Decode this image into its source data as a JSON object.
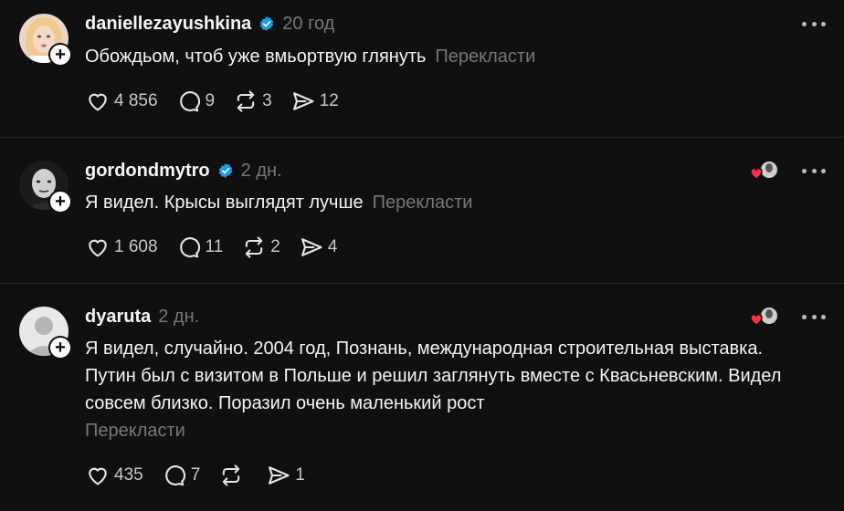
{
  "posts": [
    {
      "username": "daniellezayushkina",
      "verified": true,
      "time": "20 год",
      "text": "Обождьом, чтоб уже вмьортвую глянуть",
      "translate_label": "Перекласти",
      "likes": "4 856",
      "replies": "9",
      "reposts": "3",
      "shares": "12"
    },
    {
      "username": "gordondmytro",
      "verified": true,
      "time": "2 дн.",
      "text": "Я видел. Крысы выглядят лучше",
      "translate_label": "Перекласти",
      "likes": "1 608",
      "replies": "11",
      "reposts": "2",
      "shares": "4"
    },
    {
      "username": "dyaruta",
      "verified": false,
      "time": "2 дн.",
      "text": "Я видел, случайно. 2004 год, Познань, международная строительная выставка. Путин был с визитом в Польше и решил заглянуть вместе с Квасьневским. Видел совсем близко. Поразил очень маленький рост",
      "translate_label": "Перекласти",
      "likes": "435",
      "replies": "7",
      "reposts": "",
      "shares": "1"
    }
  ],
  "colors": {
    "background": "#101010",
    "text": "#f3f5f7",
    "muted": "#777777",
    "verified": "#1d9bf0",
    "heart": "#ff3040"
  }
}
